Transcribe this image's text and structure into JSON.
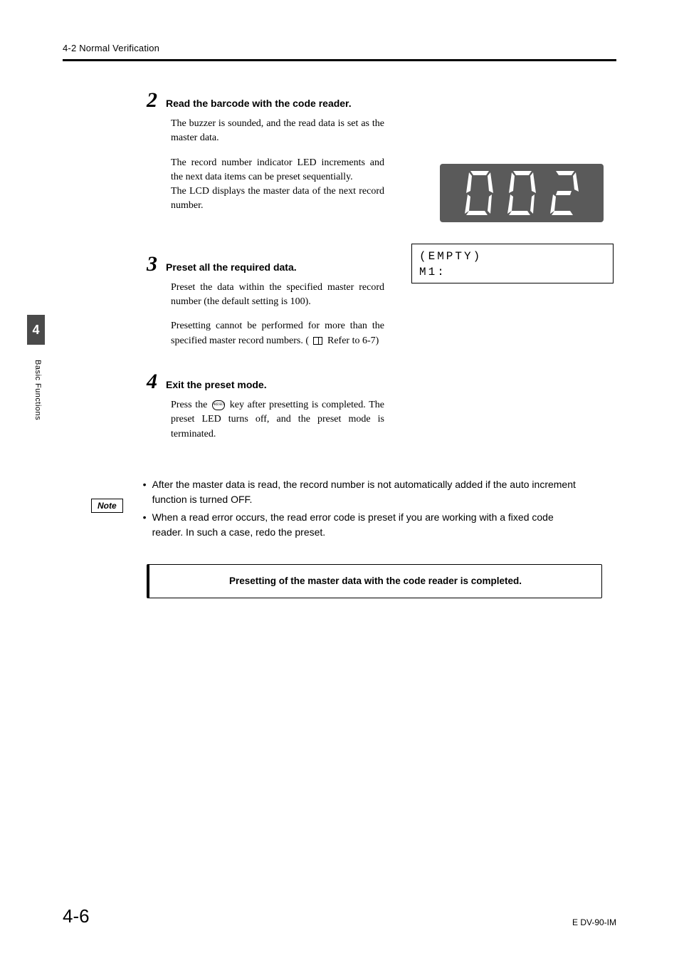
{
  "header": {
    "section": "4-2  Normal Verification"
  },
  "sideTab": {
    "chapter": "4",
    "label": "Basic Functions"
  },
  "steps": {
    "s2": {
      "num": "2",
      "title": "Read the barcode with the code reader.",
      "p1": "The buzzer is sounded, and the read data is set as the master data.",
      "p2": "The record number indicator LED increments and the next data items can be preset sequentially.",
      "p3": "The LCD displays the master data of the next record number."
    },
    "s3": {
      "num": "3",
      "title": "Preset all the required data.",
      "p1": "Preset the data within the specified master record number (the default setting is 100).",
      "p2a": "Presetting cannot be performed for more than the specified master record numbers. (",
      "p2b": "Refer to 6-7)"
    },
    "s4": {
      "num": "4",
      "title": "Exit the preset mode.",
      "p1a": "Press the ",
      "p1b": " key after presetting is completed. The preset LED turns off, and the preset mode is terminated."
    }
  },
  "lcd": {
    "line1": "(EMPTY)",
    "line2": "M1:"
  },
  "led": {
    "value": "002"
  },
  "notes": {
    "label": "Note",
    "b1": "After the master data is read, the record number is not automatically added if the auto increment function is turned OFF.",
    "b2": "When a read error occurs, the read error code is preset if you are working with a fixed code reader. In such a case, redo the preset."
  },
  "completion": "Presetting of the master data with the code reader is completed.",
  "footer": {
    "page": "4-6",
    "docid": "E DV-90-IM"
  }
}
